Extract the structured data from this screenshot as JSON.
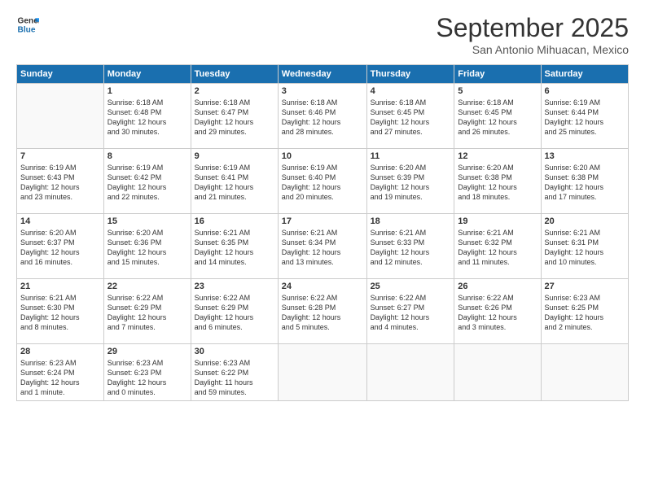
{
  "logo": {
    "line1": "General",
    "line2": "Blue"
  },
  "title": "September 2025",
  "subtitle": "San Antonio Mihuacan, Mexico",
  "days_of_week": [
    "Sunday",
    "Monday",
    "Tuesday",
    "Wednesday",
    "Thursday",
    "Friday",
    "Saturday"
  ],
  "weeks": [
    [
      {
        "num": "",
        "info": ""
      },
      {
        "num": "1",
        "info": "Sunrise: 6:18 AM\nSunset: 6:48 PM\nDaylight: 12 hours\nand 30 minutes."
      },
      {
        "num": "2",
        "info": "Sunrise: 6:18 AM\nSunset: 6:47 PM\nDaylight: 12 hours\nand 29 minutes."
      },
      {
        "num": "3",
        "info": "Sunrise: 6:18 AM\nSunset: 6:46 PM\nDaylight: 12 hours\nand 28 minutes."
      },
      {
        "num": "4",
        "info": "Sunrise: 6:18 AM\nSunset: 6:45 PM\nDaylight: 12 hours\nand 27 minutes."
      },
      {
        "num": "5",
        "info": "Sunrise: 6:18 AM\nSunset: 6:45 PM\nDaylight: 12 hours\nand 26 minutes."
      },
      {
        "num": "6",
        "info": "Sunrise: 6:19 AM\nSunset: 6:44 PM\nDaylight: 12 hours\nand 25 minutes."
      }
    ],
    [
      {
        "num": "7",
        "info": "Sunrise: 6:19 AM\nSunset: 6:43 PM\nDaylight: 12 hours\nand 23 minutes."
      },
      {
        "num": "8",
        "info": "Sunrise: 6:19 AM\nSunset: 6:42 PM\nDaylight: 12 hours\nand 22 minutes."
      },
      {
        "num": "9",
        "info": "Sunrise: 6:19 AM\nSunset: 6:41 PM\nDaylight: 12 hours\nand 21 minutes."
      },
      {
        "num": "10",
        "info": "Sunrise: 6:19 AM\nSunset: 6:40 PM\nDaylight: 12 hours\nand 20 minutes."
      },
      {
        "num": "11",
        "info": "Sunrise: 6:20 AM\nSunset: 6:39 PM\nDaylight: 12 hours\nand 19 minutes."
      },
      {
        "num": "12",
        "info": "Sunrise: 6:20 AM\nSunset: 6:38 PM\nDaylight: 12 hours\nand 18 minutes."
      },
      {
        "num": "13",
        "info": "Sunrise: 6:20 AM\nSunset: 6:38 PM\nDaylight: 12 hours\nand 17 minutes."
      }
    ],
    [
      {
        "num": "14",
        "info": "Sunrise: 6:20 AM\nSunset: 6:37 PM\nDaylight: 12 hours\nand 16 minutes."
      },
      {
        "num": "15",
        "info": "Sunrise: 6:20 AM\nSunset: 6:36 PM\nDaylight: 12 hours\nand 15 minutes."
      },
      {
        "num": "16",
        "info": "Sunrise: 6:21 AM\nSunset: 6:35 PM\nDaylight: 12 hours\nand 14 minutes."
      },
      {
        "num": "17",
        "info": "Sunrise: 6:21 AM\nSunset: 6:34 PM\nDaylight: 12 hours\nand 13 minutes."
      },
      {
        "num": "18",
        "info": "Sunrise: 6:21 AM\nSunset: 6:33 PM\nDaylight: 12 hours\nand 12 minutes."
      },
      {
        "num": "19",
        "info": "Sunrise: 6:21 AM\nSunset: 6:32 PM\nDaylight: 12 hours\nand 11 minutes."
      },
      {
        "num": "20",
        "info": "Sunrise: 6:21 AM\nSunset: 6:31 PM\nDaylight: 12 hours\nand 10 minutes."
      }
    ],
    [
      {
        "num": "21",
        "info": "Sunrise: 6:21 AM\nSunset: 6:30 PM\nDaylight: 12 hours\nand 8 minutes."
      },
      {
        "num": "22",
        "info": "Sunrise: 6:22 AM\nSunset: 6:29 PM\nDaylight: 12 hours\nand 7 minutes."
      },
      {
        "num": "23",
        "info": "Sunrise: 6:22 AM\nSunset: 6:29 PM\nDaylight: 12 hours\nand 6 minutes."
      },
      {
        "num": "24",
        "info": "Sunrise: 6:22 AM\nSunset: 6:28 PM\nDaylight: 12 hours\nand 5 minutes."
      },
      {
        "num": "25",
        "info": "Sunrise: 6:22 AM\nSunset: 6:27 PM\nDaylight: 12 hours\nand 4 minutes."
      },
      {
        "num": "26",
        "info": "Sunrise: 6:22 AM\nSunset: 6:26 PM\nDaylight: 12 hours\nand 3 minutes."
      },
      {
        "num": "27",
        "info": "Sunrise: 6:23 AM\nSunset: 6:25 PM\nDaylight: 12 hours\nand 2 minutes."
      }
    ],
    [
      {
        "num": "28",
        "info": "Sunrise: 6:23 AM\nSunset: 6:24 PM\nDaylight: 12 hours\nand 1 minute."
      },
      {
        "num": "29",
        "info": "Sunrise: 6:23 AM\nSunset: 6:23 PM\nDaylight: 12 hours\nand 0 minutes."
      },
      {
        "num": "30",
        "info": "Sunrise: 6:23 AM\nSunset: 6:22 PM\nDaylight: 11 hours\nand 59 minutes."
      },
      {
        "num": "",
        "info": ""
      },
      {
        "num": "",
        "info": ""
      },
      {
        "num": "",
        "info": ""
      },
      {
        "num": "",
        "info": ""
      }
    ]
  ]
}
